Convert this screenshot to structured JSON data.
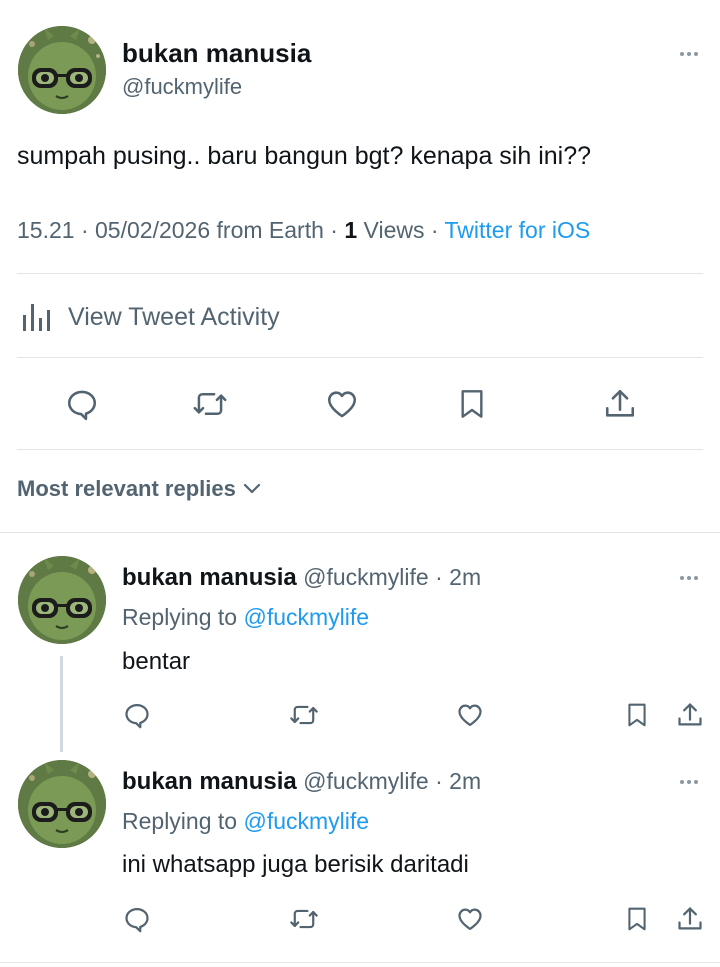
{
  "tweet": {
    "display_name": "bukan manusia",
    "handle": "@fuckmylife",
    "text": "sumpah pusing.. baru bangun bgt? kenapa sih ini??",
    "time": "15.21",
    "date": "05/02/2026",
    "location_prefix": "from",
    "location": "Earth",
    "views_count": "1",
    "views_label": "Views",
    "client": "Twitter for iOS",
    "separator": " · "
  },
  "activity": {
    "label": "View Tweet Activity",
    "icon": "bar-chart-icon"
  },
  "actions": {
    "icons": [
      "reply-icon",
      "retweet-icon",
      "like-icon",
      "bookmark-icon",
      "share-icon"
    ]
  },
  "replies_sort": {
    "label": "Most relevant replies",
    "icon": "chevron-down-icon"
  },
  "replies": [
    {
      "display_name": "bukan manusia",
      "handle": "@fuckmylife",
      "time": "2m",
      "replying_prefix": "Replying to",
      "replying_to": "@fuckmylife",
      "text": "bentar"
    },
    {
      "display_name": "bukan manusia",
      "handle": "@fuckmylife",
      "time": "2m",
      "replying_prefix": "Replying to",
      "replying_to": "@fuckmylife",
      "text": "ini whatsapp juga berisik daritadi"
    }
  ],
  "colors": {
    "text_primary": "#0f1419",
    "text_secondary": "#536471",
    "link": "#1d9bf0",
    "divider": "#e1e6ea"
  }
}
